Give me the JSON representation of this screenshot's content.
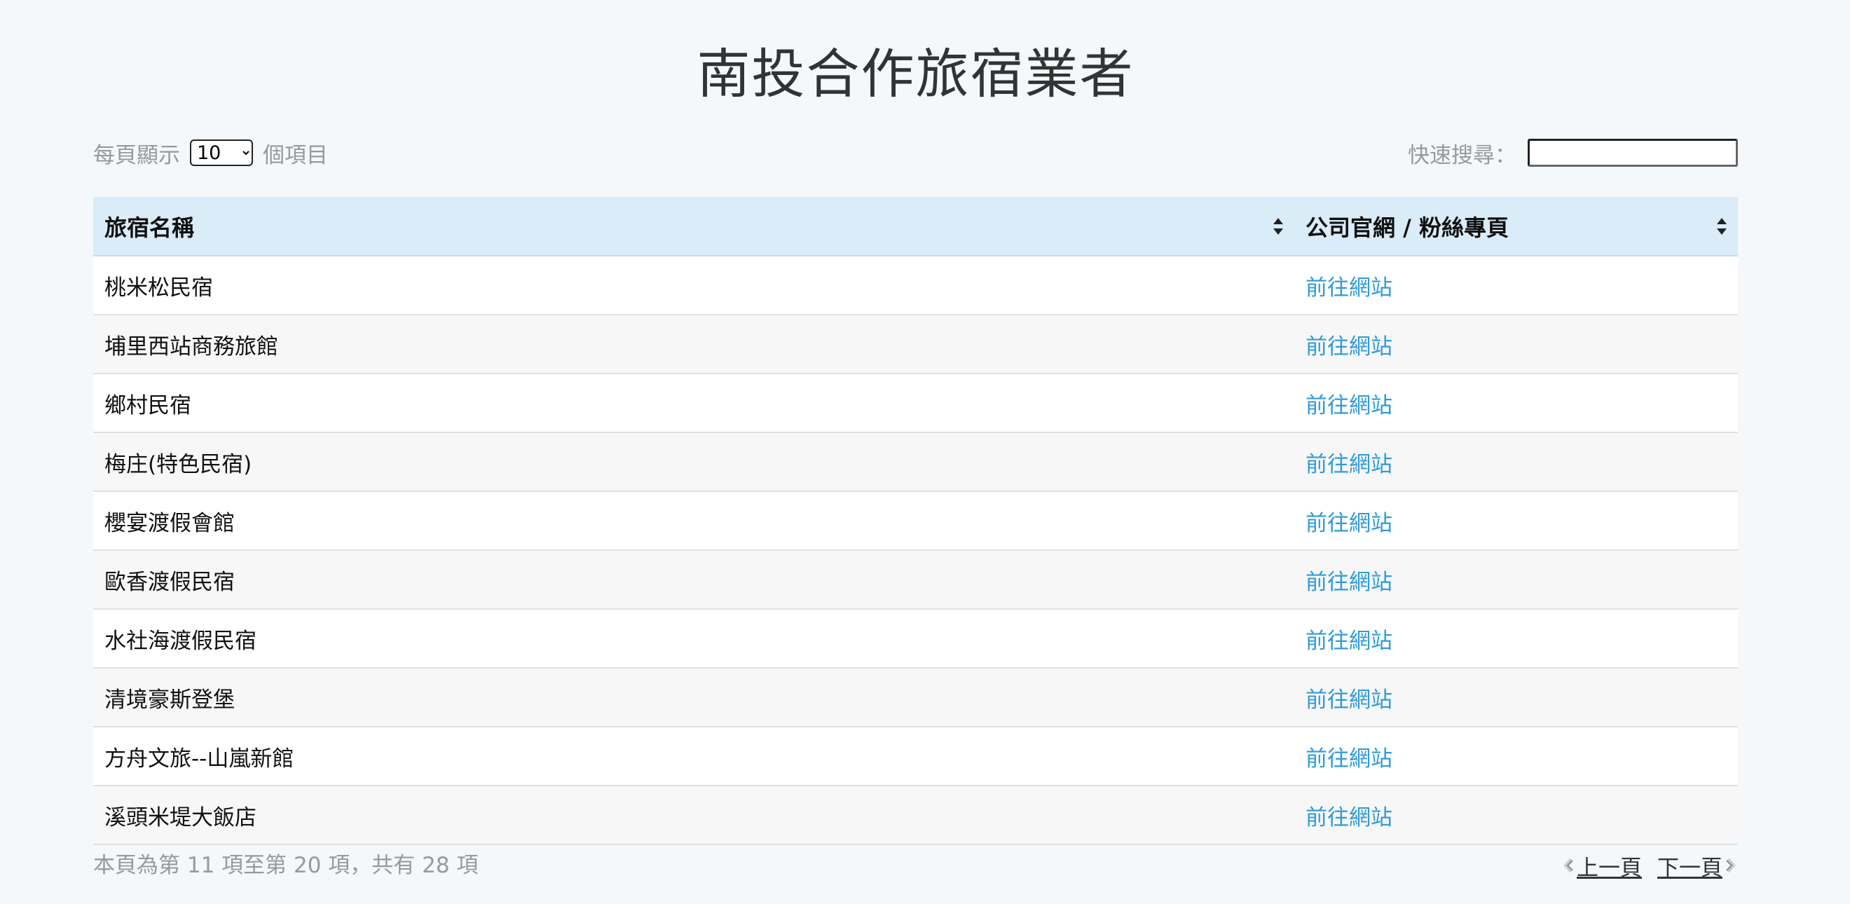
{
  "page_title": "南投合作旅宿業者",
  "length_control": {
    "prefix": "每頁顯示",
    "selected": "10",
    "options": [
      "10"
    ],
    "suffix": "個項目"
  },
  "search": {
    "label": "快速搜尋：",
    "value": ""
  },
  "table": {
    "columns": [
      "旅宿名稱",
      "公司官網 / 粉絲專頁"
    ],
    "rows": [
      {
        "name": "桃米松民宿",
        "link": "前往網站"
      },
      {
        "name": "埔里西站商務旅館",
        "link": "前往網站"
      },
      {
        "name": "鄉村民宿",
        "link": "前往網站"
      },
      {
        "name": "梅庄(特色民宿)",
        "link": "前往網站"
      },
      {
        "name": "櫻宴渡假會館",
        "link": "前往網站"
      },
      {
        "name": "歐香渡假民宿",
        "link": "前往網站"
      },
      {
        "name": "水社海渡假民宿",
        "link": "前往網站"
      },
      {
        "name": "清境豪斯登堡",
        "link": "前往網站"
      },
      {
        "name": "方舟文旅--山嵐新館",
        "link": "前往網站"
      },
      {
        "name": "溪頭米堤大飯店",
        "link": "前往網站"
      }
    ]
  },
  "info_text": "本頁為第 11 項至第 20 項，共有 28 項",
  "pagination": {
    "prev_label": "上一頁",
    "next_label": "下一頁"
  },
  "colors": {
    "header_bg": "#d9ecf7",
    "link": "#2f9bd8",
    "page_bg": "#f4f8fb"
  }
}
